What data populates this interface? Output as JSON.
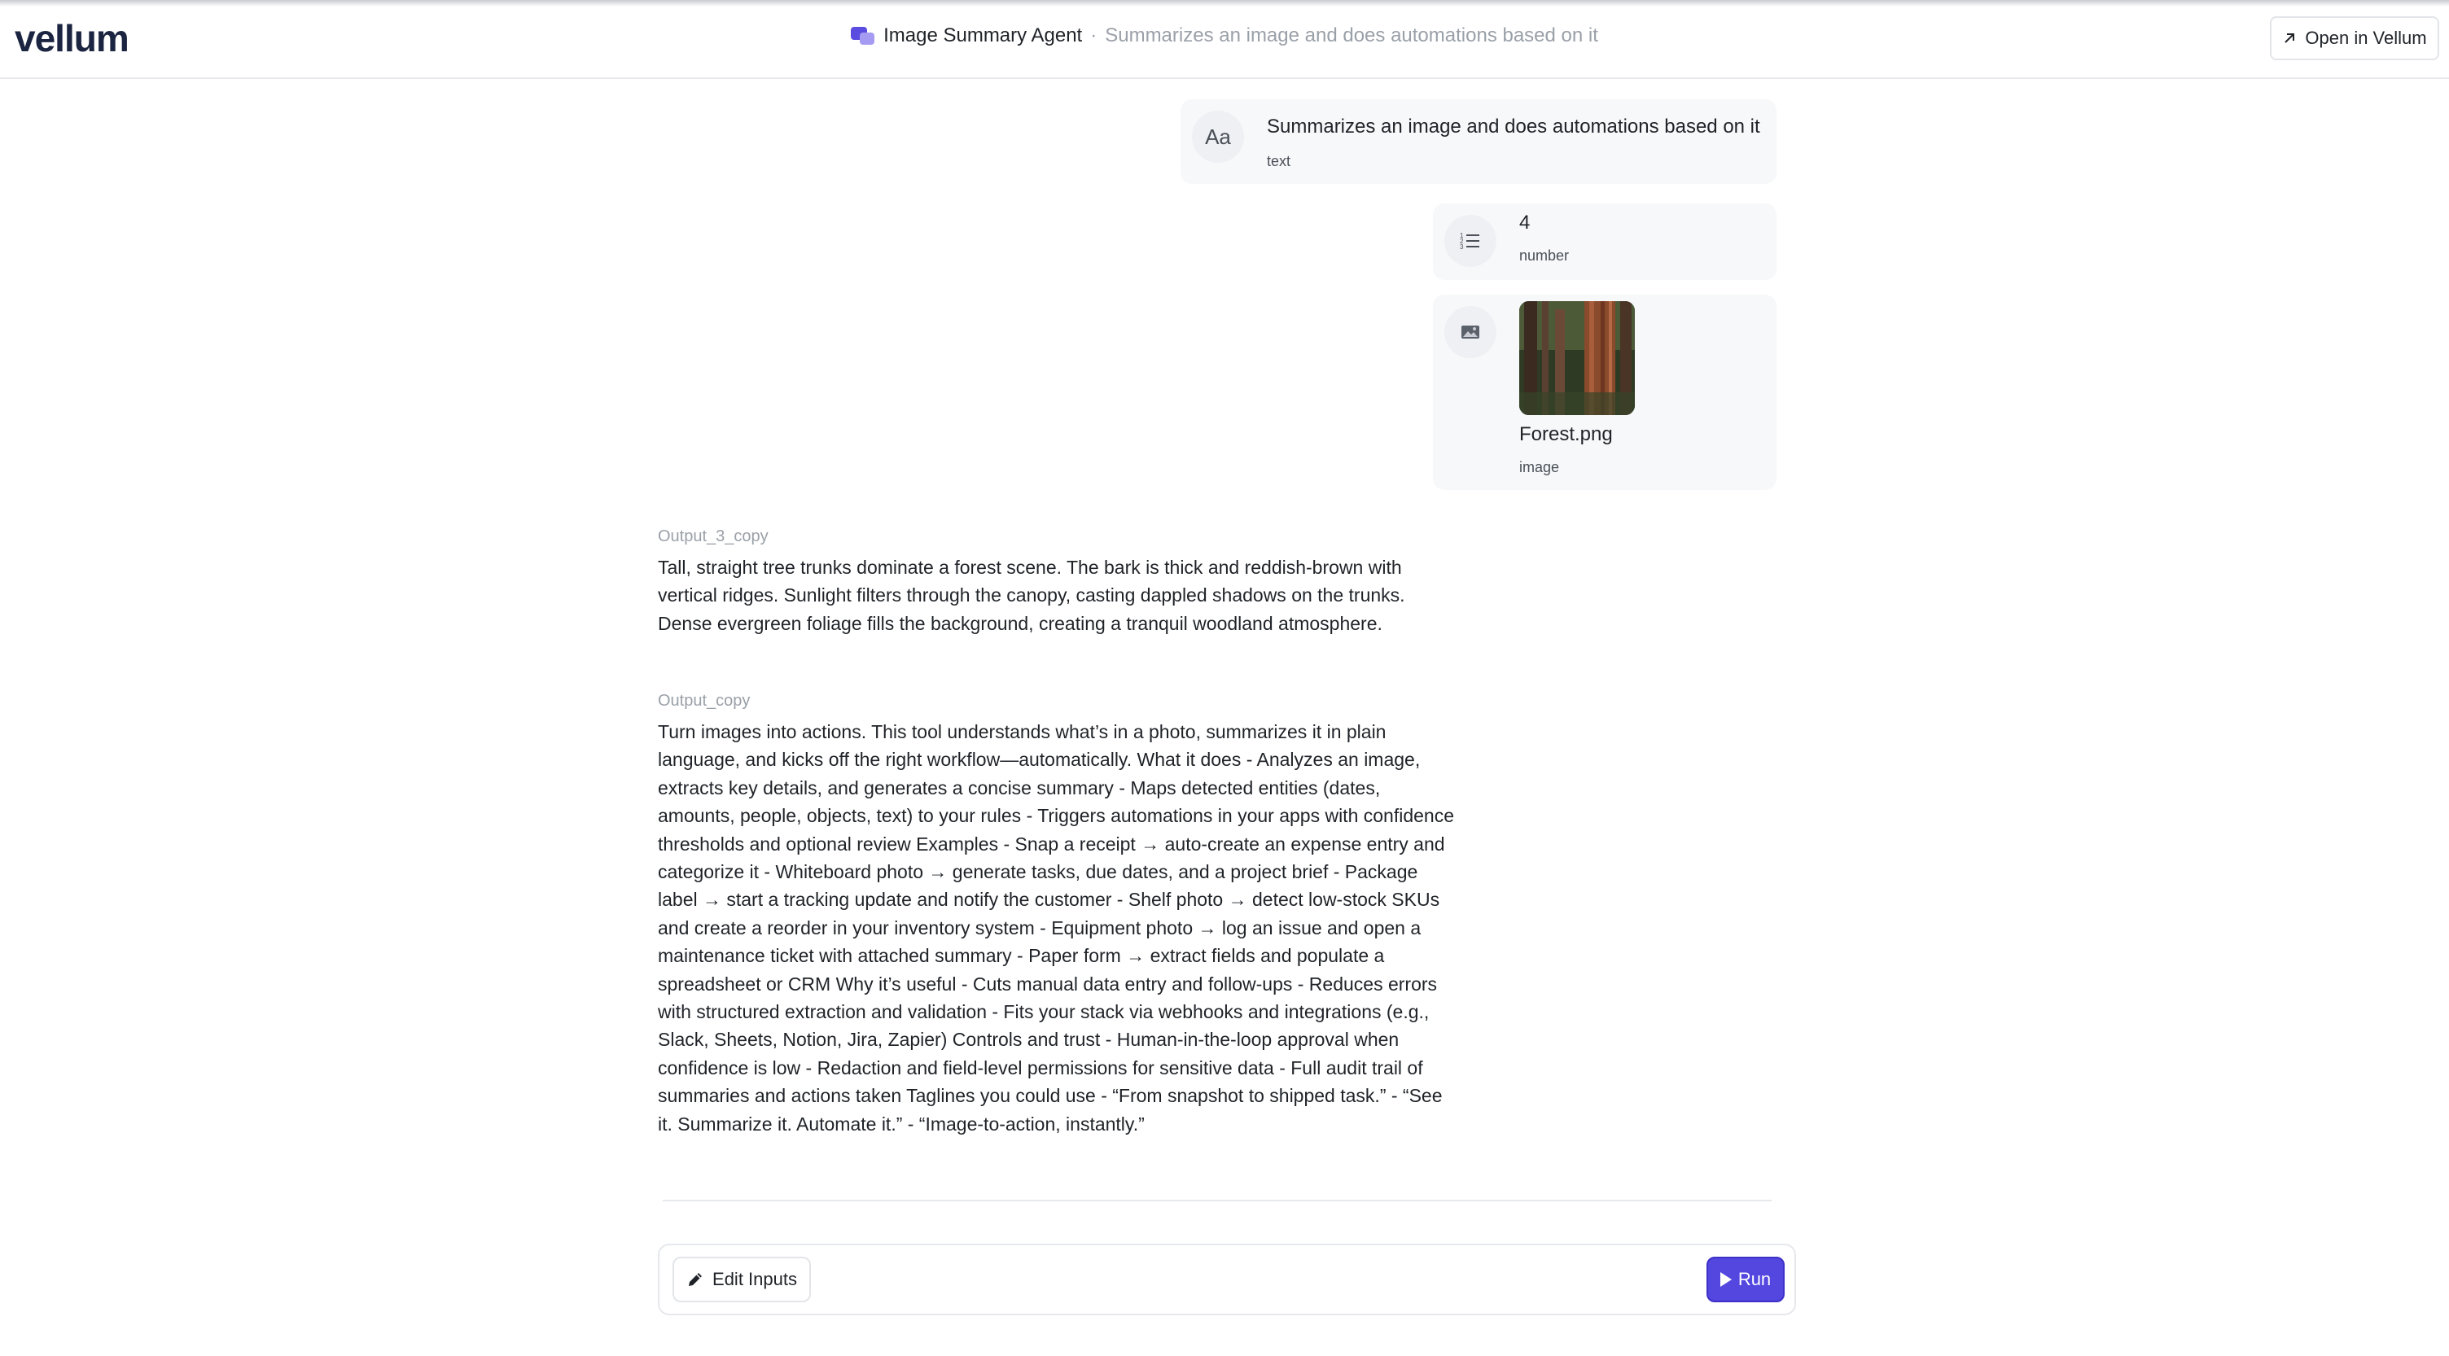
{
  "header": {
    "logo": "vellum",
    "agent_name": "Image Summary Agent",
    "separator": "·",
    "agent_description": "Summarizes an image and does automations based on it",
    "open_button_label": "Open in Vellum"
  },
  "inputs": [
    {
      "value": "Summarizes an image and does automations based on it",
      "type": "text",
      "icon": "text-type-icon",
      "icon_glyph": "Aa"
    },
    {
      "value": "4",
      "type": "number",
      "icon": "number-list-icon"
    },
    {
      "value": "Forest.png",
      "type": "image",
      "icon": "image-icon"
    }
  ],
  "outputs": [
    {
      "label": "Output_3_copy",
      "text": "Tall, straight tree trunks dominate a forest scene. The bark is thick and reddish-brown with vertical ridges. Sunlight filters through the canopy, casting dappled shadows on the trunks. Dense evergreen foliage fills the background, creating a tranquil woodland atmosphere."
    },
    {
      "label": "Output_copy",
      "text": "Turn images into actions. This tool understands what’s in a photo, summarizes it in plain language, and kicks off the right workflow—automatically. What it does - Analyzes an image, extracts key details, and generates a concise summary - Maps detected entities (dates, amounts, people, objects, text) to your rules - Triggers automations in your apps with confidence thresholds and optional review Examples - Snap a receipt → auto-create an expense entry and categorize it - Whiteboard photo → generate tasks, due dates, and a project brief - Package label → start a tracking update and notify the customer - Shelf photo → detect low-stock SKUs and create a reorder in your inventory system - Equipment photo → log an issue and open a maintenance ticket with attached summary - Paper form → extract fields and populate a spreadsheet or CRM Why it’s useful - Cuts manual data entry and follow-ups - Reduces errors with structured extraction and validation - Fits your stack via webhooks and integrations (e.g., Slack, Sheets, Notion, Jira, Zapier) Controls and trust - Human-in-the-loop approval when confidence is low - Redaction and field-level permissions for sensitive data - Full audit trail of summaries and actions taken Taglines you could use - “From snapshot to shipped task.” - “See it. Summarize it. Automate it.” - “Image-to-action, instantly.”"
    }
  ],
  "footer": {
    "edit_label": "Edit Inputs",
    "run_label": "Run"
  },
  "colors": {
    "accent": "#5347e0",
    "muted_text": "#9aa0a8",
    "card_bg": "#f7f8fa"
  }
}
